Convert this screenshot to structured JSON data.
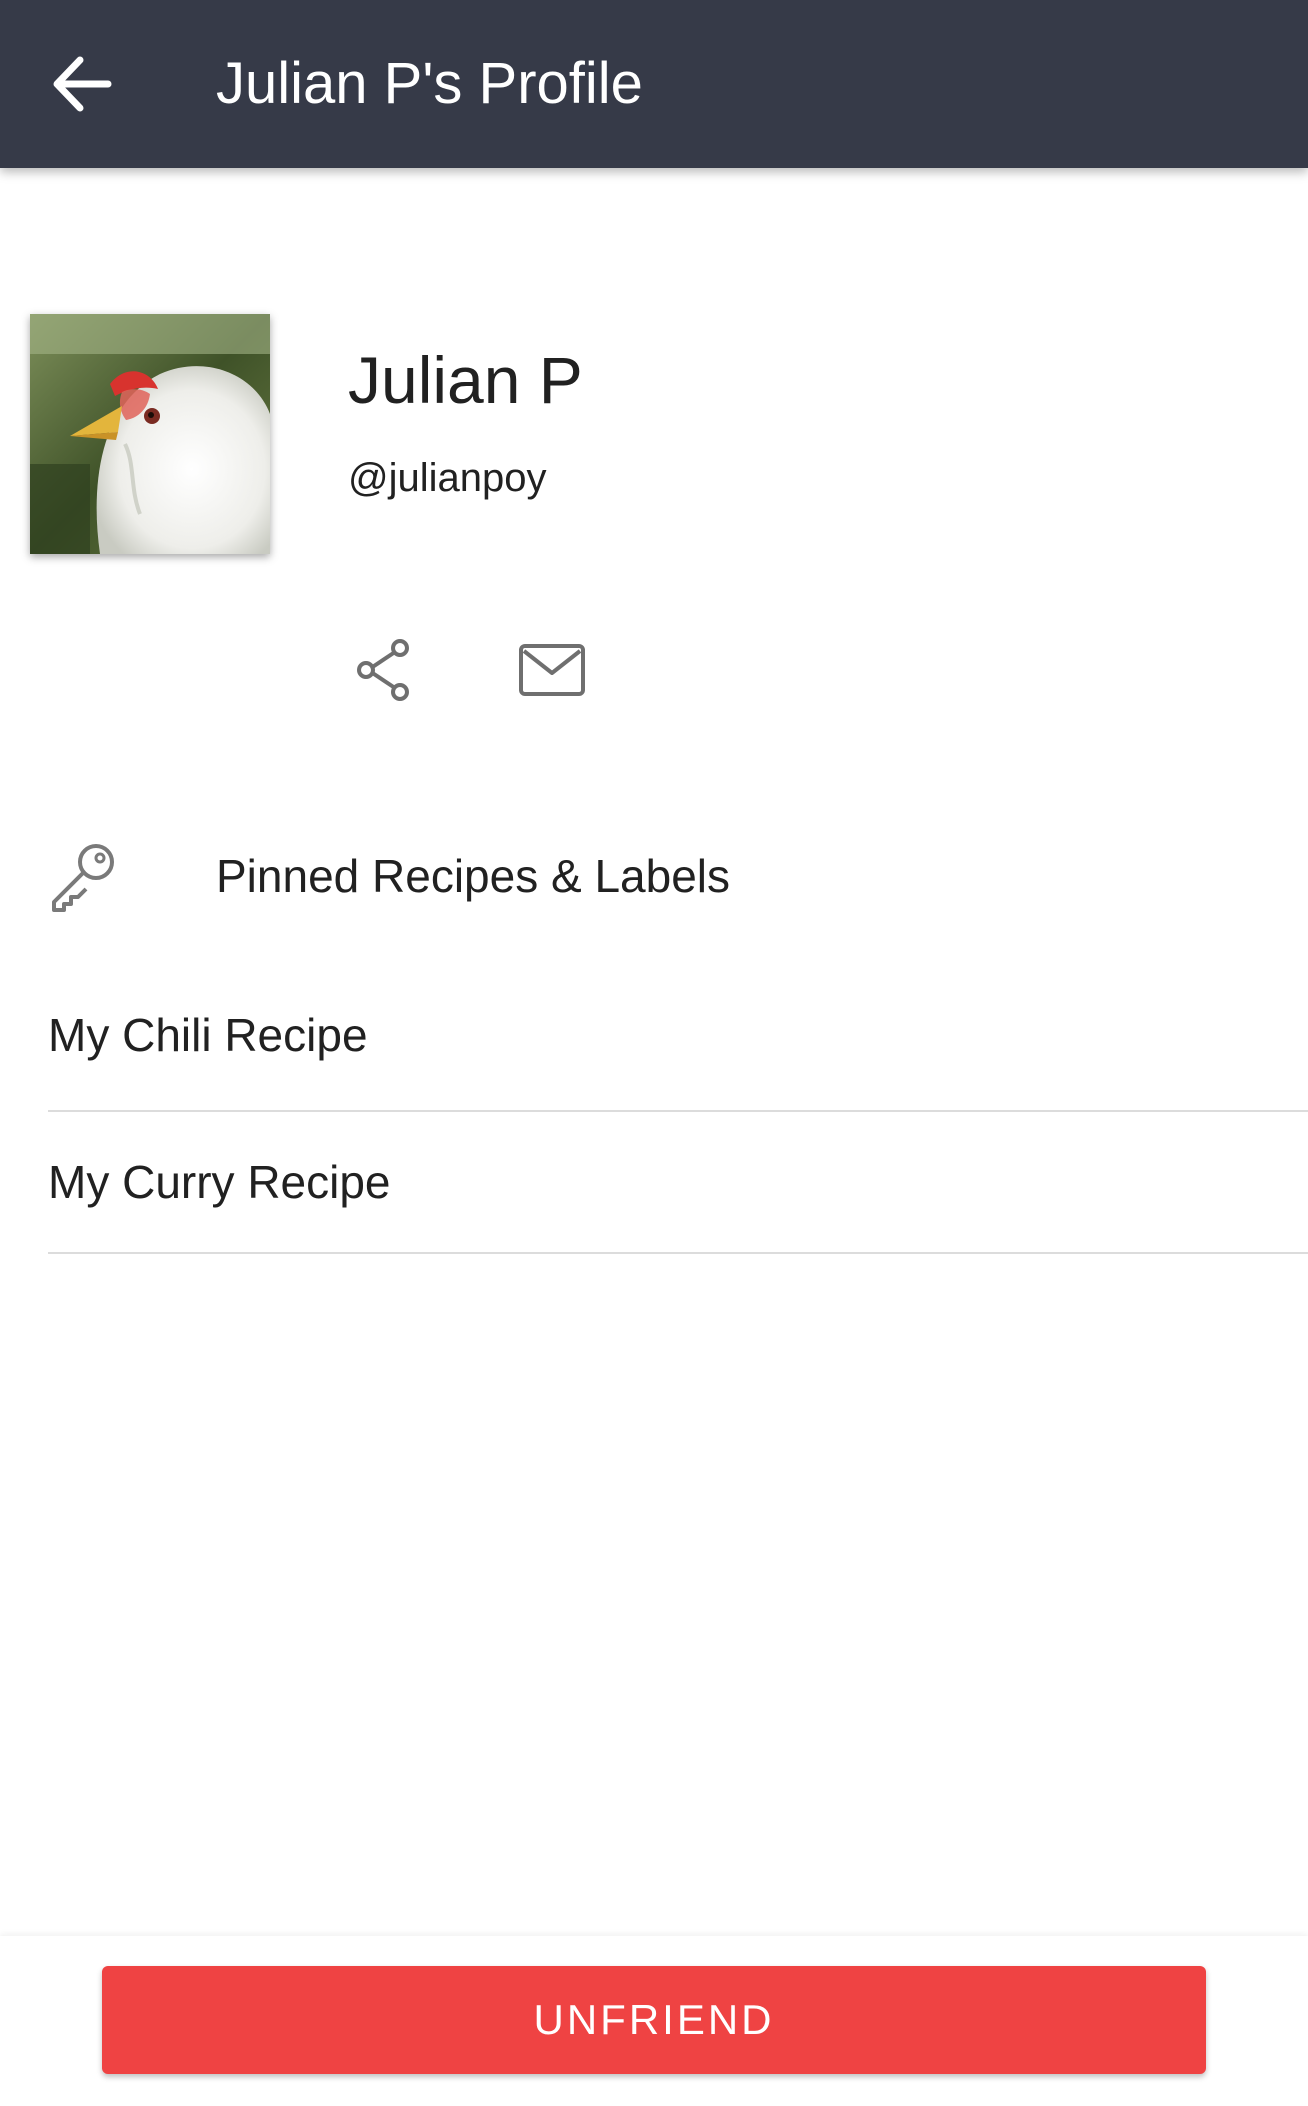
{
  "app_bar": {
    "back_icon": "arrow-left-icon",
    "title": "Julian P's Profile",
    "background_color": "#363a48"
  },
  "profile": {
    "avatar_description_icon": "chicken-photo-avatar",
    "name": "Julian P",
    "handle": "@julianpoy",
    "actions": [
      {
        "icon": "share-icon"
      },
      {
        "icon": "mail-icon"
      }
    ]
  },
  "pinned": {
    "icon": "key-icon",
    "title": "Pinned Recipes & Labels",
    "items": [
      {
        "label": "My Chili Recipe"
      },
      {
        "label": "My Curry Recipe"
      }
    ]
  },
  "footer": {
    "unfriend_label": "UNFRIEND",
    "button_color": "#ef4343"
  }
}
